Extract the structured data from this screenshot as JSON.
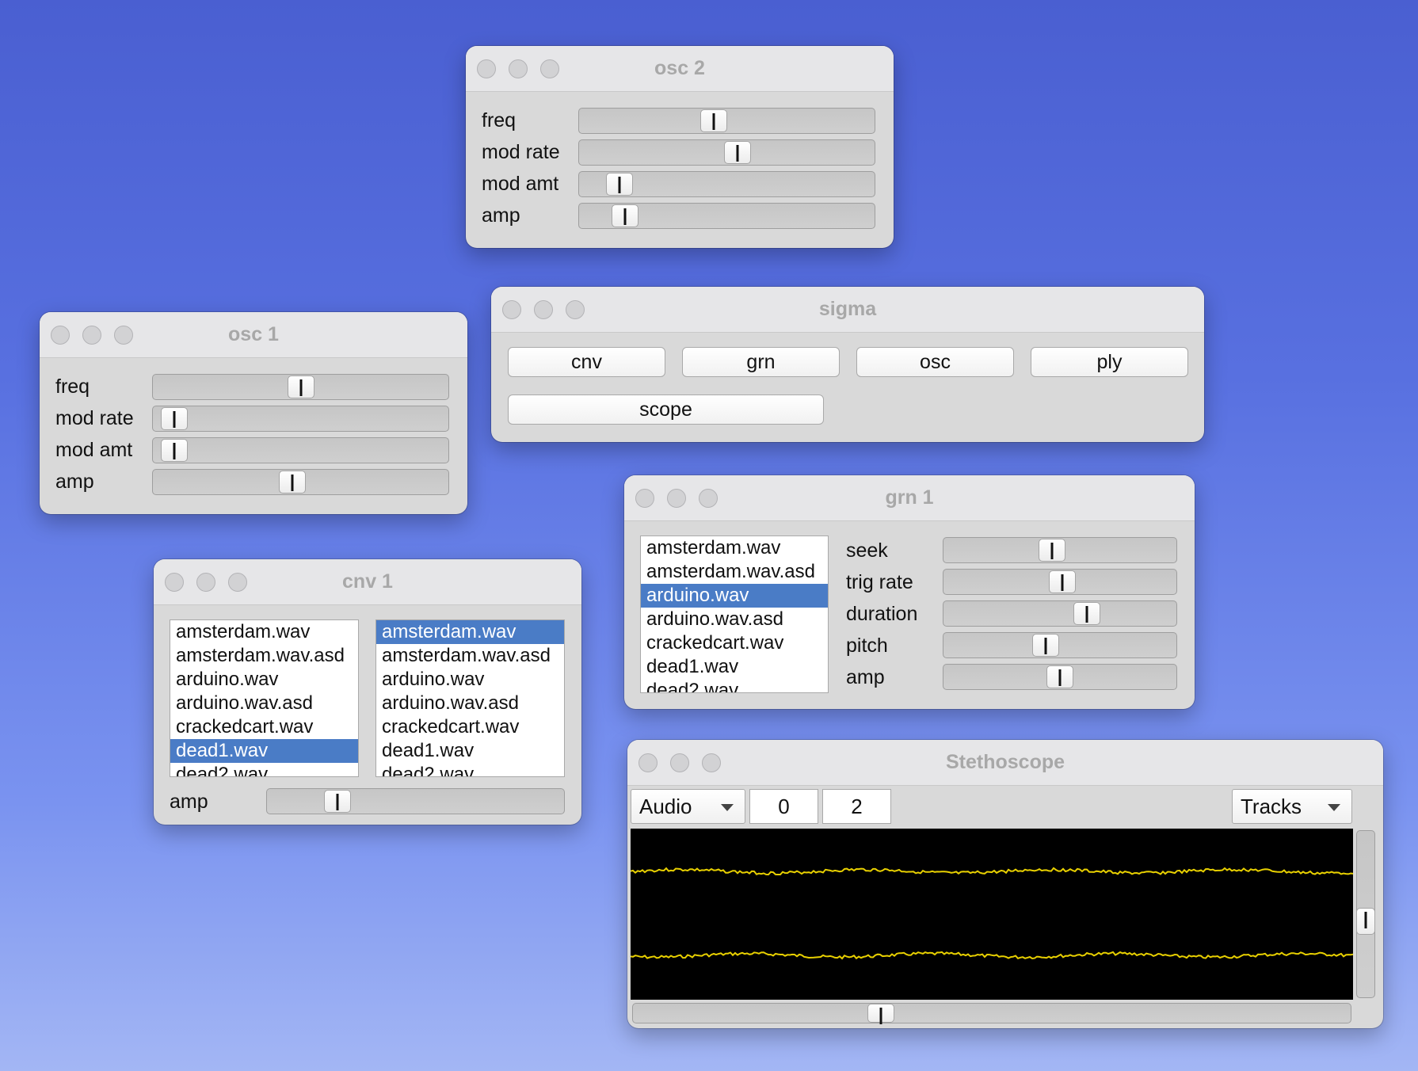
{
  "osc2": {
    "title": "osc 2",
    "rows": [
      {
        "label": "freq",
        "value": 0.45
      },
      {
        "label": "mod rate",
        "value": 0.54
      },
      {
        "label": "mod amt",
        "value": 0.1
      },
      {
        "label": "amp",
        "value": 0.12
      }
    ]
  },
  "osc1": {
    "title": "osc 1",
    "rows": [
      {
        "label": "freq",
        "value": 0.5
      },
      {
        "label": "mod rate",
        "value": 0.03
      },
      {
        "label": "mod amt",
        "value": 0.03
      },
      {
        "label": "amp",
        "value": 0.47
      }
    ]
  },
  "sigma": {
    "title": "sigma",
    "buttons": [
      "cnv",
      "grn",
      "osc",
      "ply",
      "scope"
    ]
  },
  "grn1": {
    "title": "grn  1",
    "files": [
      "amsterdam.wav",
      "amsterdam.wav.asd",
      "arduino.wav",
      "arduino.wav.asd",
      "crackedcart.wav",
      "dead1.wav",
      "dead2.wav"
    ],
    "selected": 2,
    "rows": [
      {
        "label": "seek",
        "value": 0.46
      },
      {
        "label": "trig rate",
        "value": 0.51
      },
      {
        "label": "duration",
        "value": 0.63
      },
      {
        "label": "pitch",
        "value": 0.43
      },
      {
        "label": "amp",
        "value": 0.5
      }
    ]
  },
  "cnv1": {
    "title": "cnv 1",
    "list_a": [
      "amsterdam.wav",
      "amsterdam.wav.asd",
      "arduino.wav",
      "arduino.wav.asd",
      "crackedcart.wav",
      "dead1.wav",
      "dead2.wav"
    ],
    "list_a_selected": 5,
    "list_b": [
      "amsterdam.wav",
      "amsterdam.wav.asd",
      "arduino.wav",
      "arduino.wav.asd",
      "crackedcart.wav",
      "dead1.wav",
      "dead2.wav"
    ],
    "list_b_selected": 0,
    "amp_label": "amp",
    "amp_value": 0.21
  },
  "scope": {
    "title": "Stethoscope",
    "rate_option": "Audio",
    "first_channel": "0",
    "num_channels": "2",
    "style_option": "Tracks",
    "trace_color": "#e8d000",
    "vertical_zoom": 0.55,
    "horizontal_zoom": 0.34
  }
}
